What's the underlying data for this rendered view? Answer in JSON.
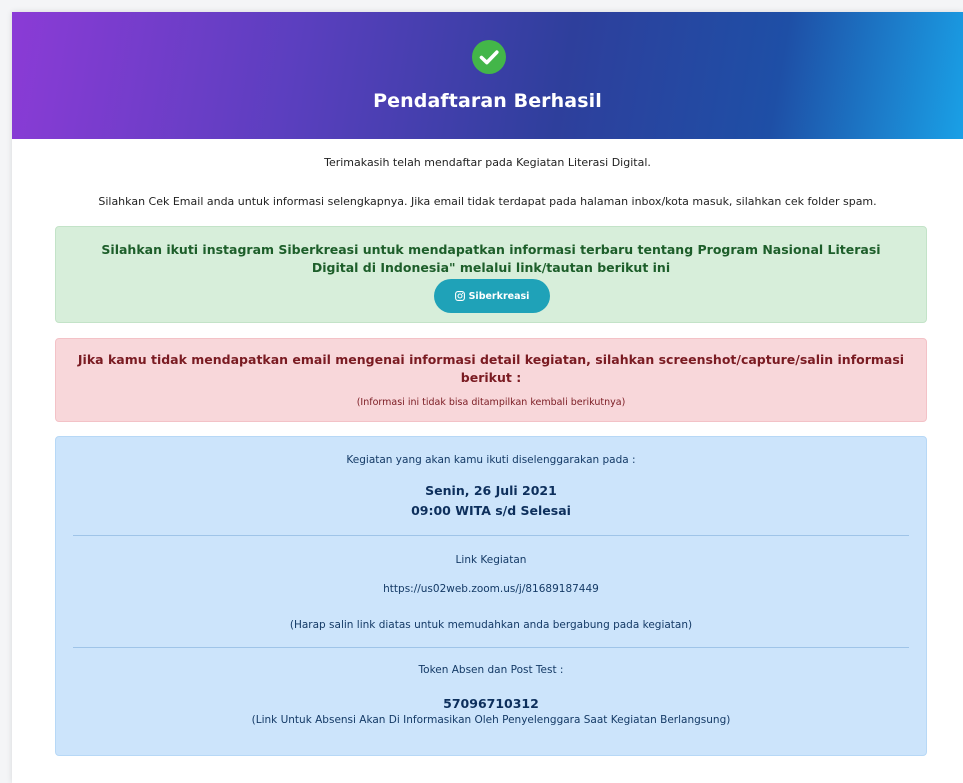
{
  "header": {
    "title": "Pendaftaran Berhasil",
    "icon": "check-circle-icon"
  },
  "intro": {
    "thanks": "Terimakasih telah mendaftar pada Kegiatan Literasi Digital.",
    "email_note": "Silahkan Cek Email anda untuk informasi selengkapnya. Jika email tidak terdapat pada halaman inbox/kota masuk, silahkan cek folder spam."
  },
  "instagram_box": {
    "message": "Silahkan ikuti instagram Siberkreasi untuk mendapatkan informasi terbaru tentang Program Nasional Literasi Digital di Indonesia\" melalui link/tautan berikut ini",
    "button_label": "Siberkreasi",
    "button_icon": "instagram-icon"
  },
  "warning_box": {
    "message": "Jika kamu tidak mendapatkan email mengenai informasi detail kegiatan, silahkan screenshot/capture/salin informasi berikut :",
    "sub": "(Informasi ini tidak bisa ditampilkan kembali berikutnya)"
  },
  "info_box": {
    "schedule_label": "Kegiatan yang akan kamu ikuti diselenggarakan pada :",
    "date": "Senin, 26 Juli 2021",
    "time": "09:00 WITA s/d Selesai",
    "link_label": "Link Kegiatan",
    "link_url": "https://us02web.zoom.us/j/81689187449",
    "link_note": "(Harap salin link diatas untuk memudahkan anda bergabung pada kegiatan)",
    "token_label": "Token Absen dan Post Test :",
    "token_value": "57096710312",
    "token_note": "(Link Untuk Absensi Akan Di Informasikan Oleh Penyelenggara Saat Kegiatan Berlangsung)"
  },
  "colors": {
    "success_green": "#43b649",
    "button_teal": "#1fa2b8",
    "success_bg": "#d7eeda",
    "danger_bg": "#f8d7da",
    "info_bg": "#cce4fb"
  }
}
